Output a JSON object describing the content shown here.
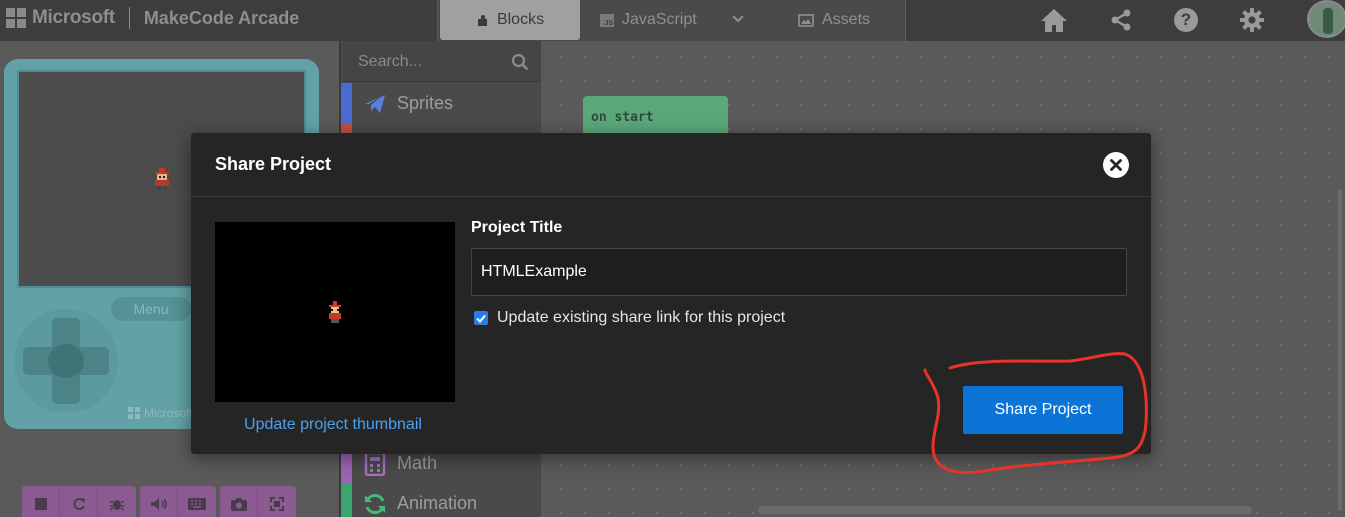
{
  "header": {
    "brand": "Microsoft",
    "app_name": "MakeCode Arcade",
    "tabs": [
      {
        "label": "Blocks",
        "icon": "puzzle-icon",
        "active": true
      },
      {
        "label": "JavaScript",
        "icon": "js-icon",
        "active": false
      },
      {
        "label": "Assets",
        "icon": "image-icon",
        "active": false
      }
    ],
    "js_badge": "JS",
    "actions": [
      "home-icon",
      "share-icon",
      "help-icon",
      "gear-icon",
      "avatar"
    ],
    "help_glyph": "?"
  },
  "simulator": {
    "menu_label": "Menu",
    "brand": "Microsoft",
    "console_color": "#62a2a6",
    "buttons": [
      [
        "stop-icon",
        "restart-icon",
        "debug-icon"
      ],
      [
        "sound-icon",
        "keyboard-icon"
      ],
      [
        "screenshot-icon",
        "fullscreen-icon"
      ]
    ]
  },
  "toolbox": {
    "search_placeholder": "Search...",
    "categories": [
      {
        "label": "Sprites",
        "color": "#4b6bd1",
        "icon": "paper-plane-icon"
      },
      {
        "label": "Math",
        "color": "#9b64b4",
        "icon": "calculator-icon"
      },
      {
        "label": "Animation",
        "color": "#3aa56e",
        "icon": "refresh-icon"
      }
    ]
  },
  "workspace": {
    "block_label": "on start",
    "block_color": "#5ba77a"
  },
  "modal": {
    "title": "Share Project",
    "thumbnail_link": "Update project thumbnail",
    "field_label": "Project Title",
    "project_title": "HTMLExample",
    "checkbox_label": "Update existing share link for this project",
    "checkbox_checked": true,
    "share_button": "Share Project",
    "accent": "#0b74d6"
  }
}
